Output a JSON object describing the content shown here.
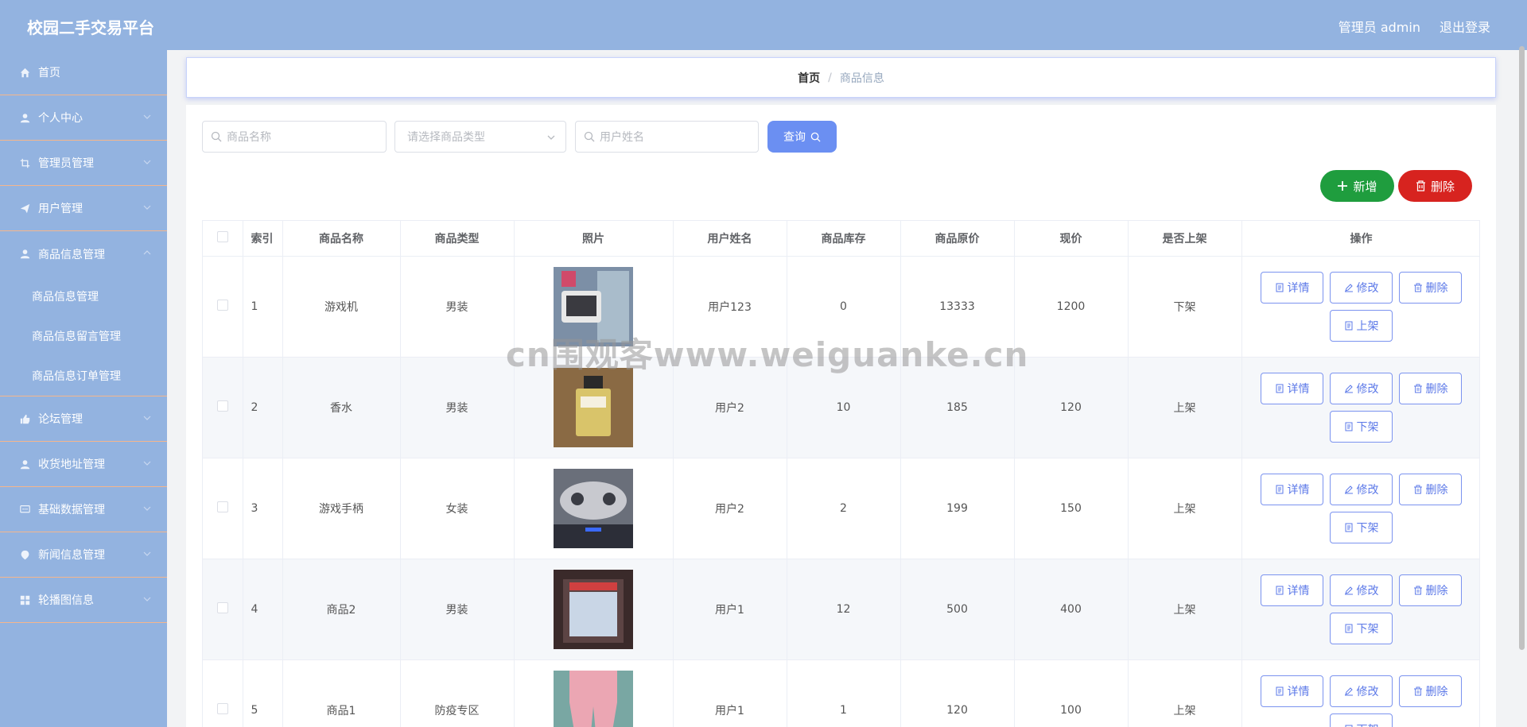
{
  "header": {
    "title": "校园二手交易平台",
    "admin_label": "管理员 admin",
    "logout_label": "退出登录"
  },
  "sidebar": {
    "items": [
      {
        "label": "首页",
        "icon": "home-icon"
      },
      {
        "label": "个人中心",
        "icon": "user-icon"
      },
      {
        "label": "管理员管理",
        "icon": "crop-icon"
      },
      {
        "label": "用户管理",
        "icon": "send-icon"
      },
      {
        "label": "商品信息管理",
        "icon": "user-icon"
      },
      {
        "label": "论坛管理",
        "icon": "thumb-icon"
      },
      {
        "label": "收货地址管理",
        "icon": "user-icon"
      },
      {
        "label": "基础数据管理",
        "icon": "chat-icon"
      },
      {
        "label": "新闻信息管理",
        "icon": "location-icon"
      },
      {
        "label": "轮播图信息",
        "icon": "grid-icon"
      }
    ],
    "sub_items": [
      "商品信息管理",
      "商品信息留言管理",
      "商品信息订单管理"
    ]
  },
  "breadcrumb": {
    "home": "首页",
    "separator": "/",
    "current": "商品信息"
  },
  "search": {
    "name_placeholder": "商品名称",
    "type_placeholder": "请选择商品类型",
    "user_placeholder": "用户姓名",
    "query_label": "查询"
  },
  "actions": {
    "add_label": "新增",
    "delete_label": "删除"
  },
  "table": {
    "headers": [
      "索引",
      "商品名称",
      "商品类型",
      "照片",
      "用户姓名",
      "商品库存",
      "商品原价",
      "现价",
      "是否上架",
      "操作"
    ],
    "op_labels": {
      "detail": "详情",
      "edit": "修改",
      "delete": "删除"
    },
    "rows": [
      {
        "index": "1",
        "name": "游戏机",
        "type": "男装",
        "user": "用户123",
        "stock": "0",
        "original_price": "13333",
        "price": "1200",
        "on_shelf": "下架",
        "toggle": "上架"
      },
      {
        "index": "2",
        "name": "香水",
        "type": "男装",
        "user": "用户2",
        "stock": "10",
        "original_price": "185",
        "price": "120",
        "on_shelf": "上架",
        "toggle": "下架"
      },
      {
        "index": "3",
        "name": "游戏手柄",
        "type": "女装",
        "user": "用户2",
        "stock": "2",
        "original_price": "199",
        "price": "150",
        "on_shelf": "上架",
        "toggle": "下架"
      },
      {
        "index": "4",
        "name": "商品2",
        "type": "男装",
        "user": "用户1",
        "stock": "12",
        "original_price": "500",
        "price": "400",
        "on_shelf": "上架",
        "toggle": "下架"
      },
      {
        "index": "5",
        "name": "商品1",
        "type": "防疫专区",
        "user": "用户1",
        "stock": "1",
        "original_price": "120",
        "price": "100",
        "on_shelf": "上架",
        "toggle": "下架"
      }
    ]
  },
  "watermark": "cn围观客www.weiguanke.cn",
  "colors": {
    "header_bg": "#93b3e0",
    "primary": "#6b8ff2",
    "success": "#1f9d3e",
    "danger": "#d7231f"
  }
}
